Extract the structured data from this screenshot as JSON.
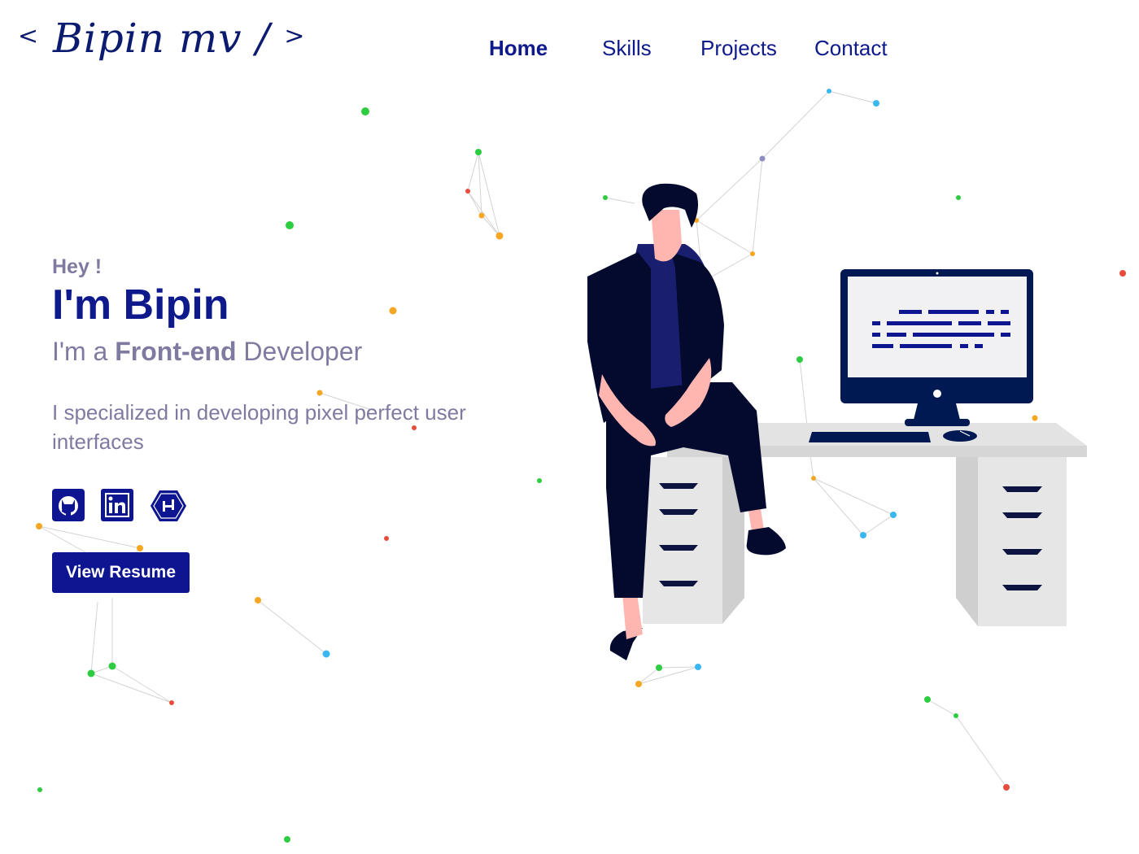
{
  "logo": {
    "open": "<",
    "text": "Bipin mv",
    "slash": "/",
    "close": ">"
  },
  "nav": {
    "items": [
      {
        "label": "Home",
        "active": true
      },
      {
        "label": "Skills",
        "active": false
      },
      {
        "label": "Projects",
        "active": false
      },
      {
        "label": "Contact",
        "active": false
      }
    ]
  },
  "hero": {
    "greeting": "Hey !",
    "name": "I'm Bipin",
    "role_prefix": "I'm a ",
    "role_highlight": "Front-end",
    "role_suffix": " Developer",
    "description": "I specialized in developing pixel perfect user interfaces",
    "resume_button": "View Resume"
  },
  "socials": [
    {
      "name": "GitHub",
      "icon": "github-icon"
    },
    {
      "name": "LinkedIn",
      "icon": "linkedin-icon"
    },
    {
      "name": "Hackerrank",
      "icon": "hackerrank-icon"
    }
  ],
  "colors": {
    "primary": "#0e1a8c",
    "muted_text": "#7f7aa0",
    "button_bg": "#0e1591",
    "illustration_dark": "#030a2e",
    "desk": "#e3e3e3"
  }
}
